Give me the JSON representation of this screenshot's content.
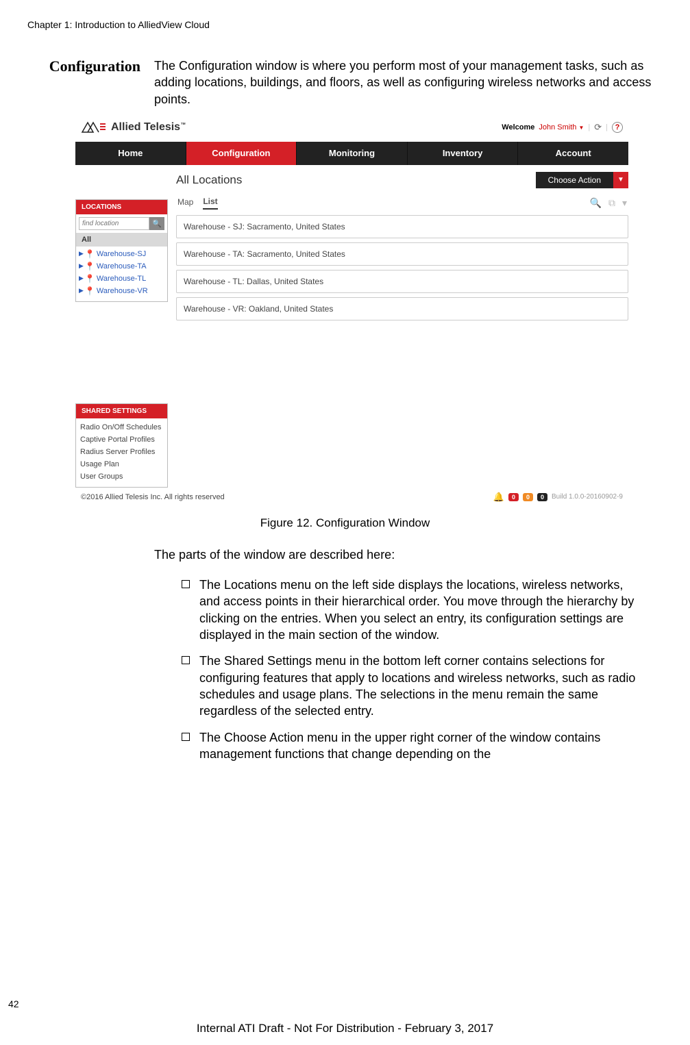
{
  "chapter_head": "Chapter 1: Introduction to AlliedView Cloud",
  "section_title": "Configuration",
  "section_intro": "The Configuration window is where you perform most of your management tasks, such as adding locations, buildings, and floors, as well as configuring wireless networks and access points.",
  "screenshot": {
    "logo_text": "Allied Telesis",
    "welcome_label": "Welcome",
    "welcome_name": "John Smith",
    "nav": [
      "Home",
      "Configuration",
      "Monitoring",
      "Inventory",
      "Account"
    ],
    "nav_active_index": 1,
    "sidebar": {
      "locations_head": "LOCATIONS",
      "search_placeholder": "find location",
      "all_label": "All",
      "tree": [
        "Warehouse-SJ",
        "Warehouse-TA",
        "Warehouse-TL",
        "Warehouse-VR"
      ],
      "shared_head": "SHARED SETTINGS",
      "shared_items": [
        "Radio On/Off Schedules",
        "Captive Portal Profiles",
        "Radius Server Profiles",
        "Usage Plan",
        "User Groups"
      ]
    },
    "main": {
      "title": "All Locations",
      "choose_action": "Choose Action",
      "tabs": [
        "Map",
        "List"
      ],
      "tab_active_index": 1,
      "locations": [
        "Warehouse - SJ: Sacramento, United States",
        "Warehouse - TA: Sacramento, United States",
        "Warehouse - TL: Dallas, United States",
        "Warehouse - VR: Oakland, United States"
      ]
    },
    "footer": {
      "copyright": "©2016 Allied Telesis Inc. All rights reserved",
      "badges": [
        "0",
        "0",
        "0"
      ],
      "build": "Build 1.0.0-20160902-9"
    }
  },
  "figure_caption": "Figure 12. Configuration Window",
  "body_p1": "The parts of the window are described here:",
  "bullets": [
    "The Locations menu on the left side displays the locations, wireless networks, and access points in their hierarchical order. You move through the hierarchy by clicking on the entries. When you select an entry, its configuration settings are displayed in the main section of the window.",
    "The Shared Settings menu in the bottom left corner contains selections for configuring features that apply to locations and wireless networks, such as radio schedules and usage plans. The selections in the menu remain the same regardless of the selected entry.",
    "The Choose Action menu in the upper right corner of the window contains management functions that change depending on the"
  ],
  "page_number": "42",
  "page_footer": "Internal ATI Draft - Not For Distribution - February 3, 2017"
}
